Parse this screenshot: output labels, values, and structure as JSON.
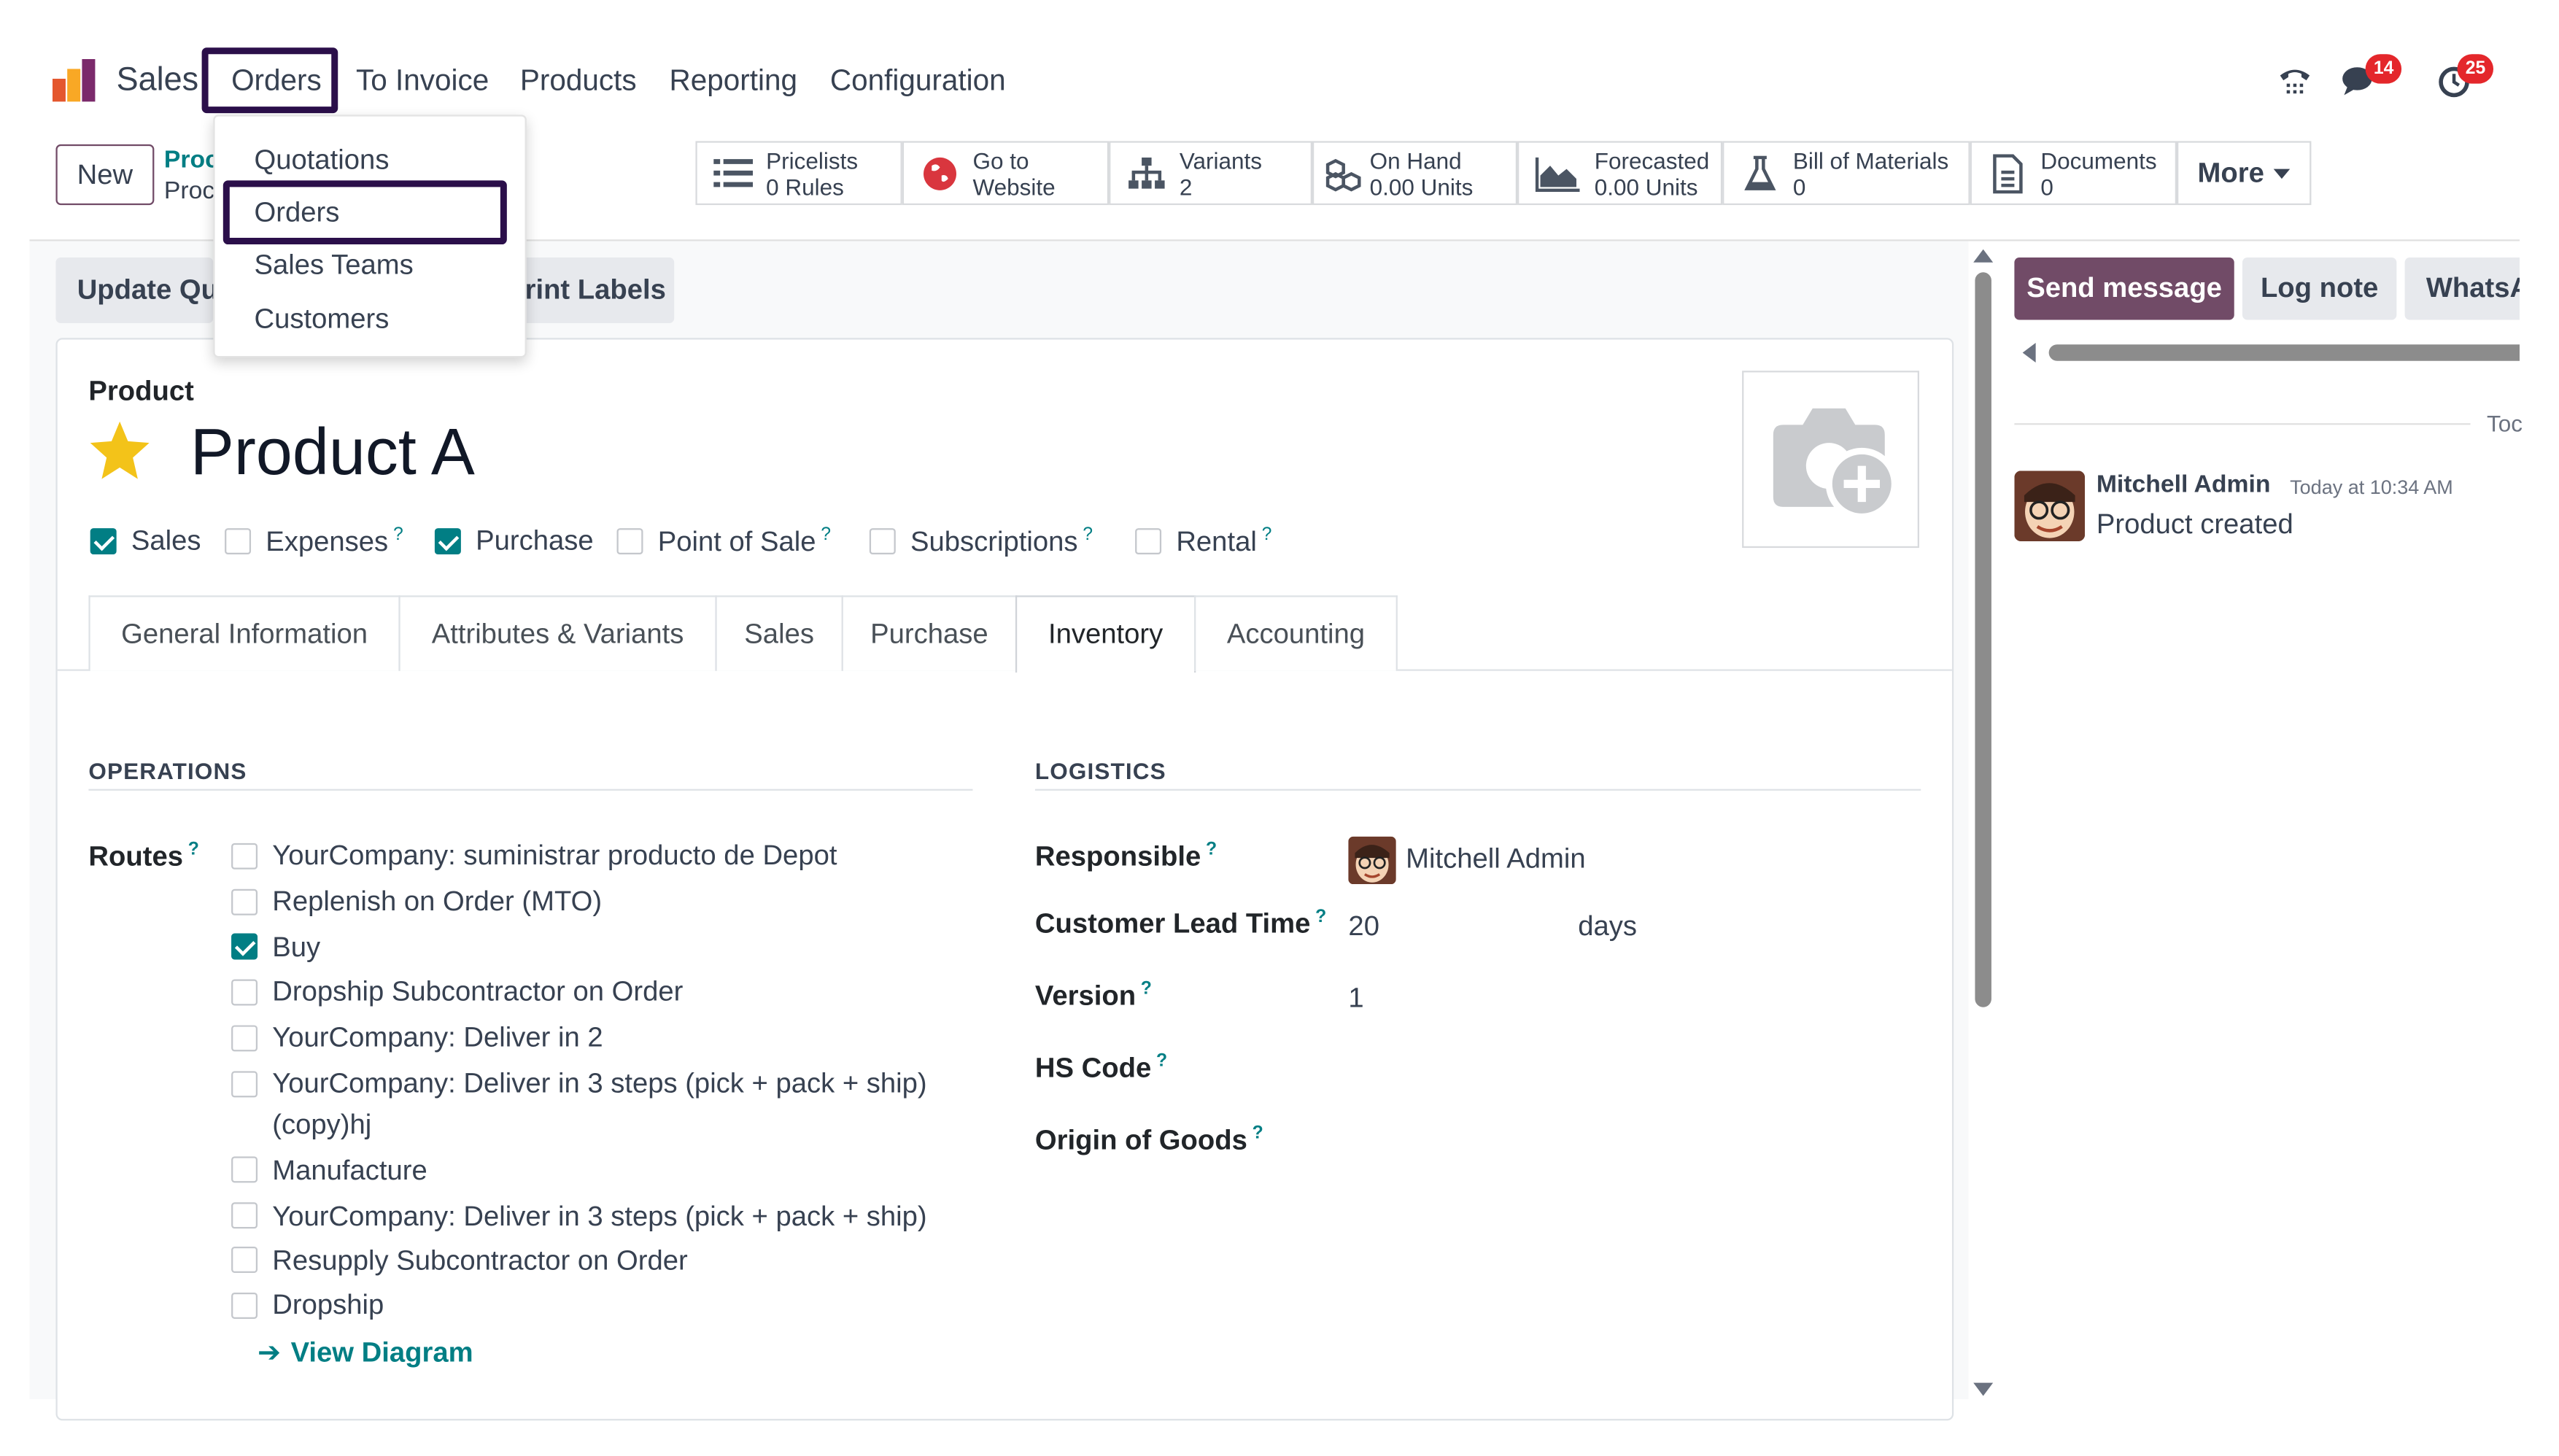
{
  "app": {
    "name": "Sales"
  },
  "nav": {
    "orders": "Orders",
    "to_invoice": "To Invoice",
    "products": "Products",
    "reporting": "Reporting",
    "configuration": "Configuration"
  },
  "systray": {
    "messages_count": "14",
    "activities_count": "25"
  },
  "dropdown": {
    "items": [
      "Quotations",
      "Orders",
      "Sales Teams",
      "Customers"
    ]
  },
  "control": {
    "new_button": "New",
    "breadcrumb_top": "Proc",
    "breadcrumb_bottom": "Proc"
  },
  "smart_buttons": [
    {
      "line1": "Pricelists",
      "line2": "0  Rules",
      "icon": "list-icon"
    },
    {
      "line1": "Go to",
      "line2": "Website",
      "icon": "globe-icon"
    },
    {
      "line1": "Variants",
      "line2": "2",
      "icon": "sitemap-icon"
    },
    {
      "line1": "On Hand",
      "line2": "0.00 Units",
      "icon": "cubes-icon"
    },
    {
      "line1": "Forecasted",
      "line2": "0.00 Units",
      "icon": "area-chart-icon"
    },
    {
      "line1": "Bill of Materials",
      "line2": "0",
      "icon": "flask-icon"
    },
    {
      "line1": "Documents",
      "line2": "0",
      "icon": "document-icon"
    }
  ],
  "more_button": "More",
  "actions": {
    "update_qty": "Update Qu",
    "print_labels": "rint Labels"
  },
  "product": {
    "label": "Product",
    "name": "Product A",
    "options": [
      {
        "label": "Sales",
        "checked": true,
        "help": ""
      },
      {
        "label": "Expenses",
        "checked": false,
        "help": "?"
      },
      {
        "label": "Purchase",
        "checked": true,
        "help": ""
      },
      {
        "label": "Point of Sale",
        "checked": false,
        "help": "?"
      },
      {
        "label": "Subscriptions",
        "checked": false,
        "help": "?"
      },
      {
        "label": "Rental",
        "checked": false,
        "help": "?"
      }
    ]
  },
  "tabs": [
    "General Information",
    "Attributes & Variants",
    "Sales",
    "Purchase",
    "Inventory",
    "Accounting"
  ],
  "active_tab": "Inventory",
  "operations": {
    "title": "OPERATIONS",
    "routes_label": "Routes",
    "routes": [
      {
        "label": "YourCompany: suministrar producto de Depot",
        "checked": false
      },
      {
        "label": "Replenish on Order (MTO)",
        "checked": false
      },
      {
        "label": "Buy",
        "checked": true
      },
      {
        "label": "Dropship Subcontractor on Order",
        "checked": false
      },
      {
        "label": "YourCompany: Deliver in 2",
        "checked": false
      },
      {
        "label": "YourCompany: Deliver in 3 steps (pick + pack + ship)",
        "label2": "(copy)hj",
        "checked": false
      },
      {
        "label": "Manufacture",
        "checked": false
      },
      {
        "label": "YourCompany: Deliver in 3 steps (pick + pack + ship)",
        "checked": false
      },
      {
        "label": "Resupply Subcontractor on Order",
        "checked": false
      },
      {
        "label": "Dropship",
        "checked": false
      }
    ],
    "view_diagram": "View Diagram"
  },
  "logistics": {
    "title": "LOGISTICS",
    "responsible_label": "Responsible",
    "responsible_value": "Mitchell Admin",
    "lead_time_label": "Customer Lead Time",
    "lead_time_value": "20",
    "lead_time_unit": "days",
    "version_label": "Version",
    "version_value": "1",
    "hs_code_label": "HS Code",
    "origin_label": "Origin of Goods"
  },
  "chatter": {
    "send_message": "Send message",
    "log_note": "Log note",
    "whatsapp": "WhatsA",
    "date_separator": "Toc",
    "author": "Mitchell Admin",
    "time": "Today at 10:34 AM",
    "body": "Product created"
  },
  "colors": {
    "brand_purple": "#714b67",
    "accent_teal": "#017e84",
    "highlight_box": "#2b0f4a",
    "badge_red": "#e4272b"
  }
}
